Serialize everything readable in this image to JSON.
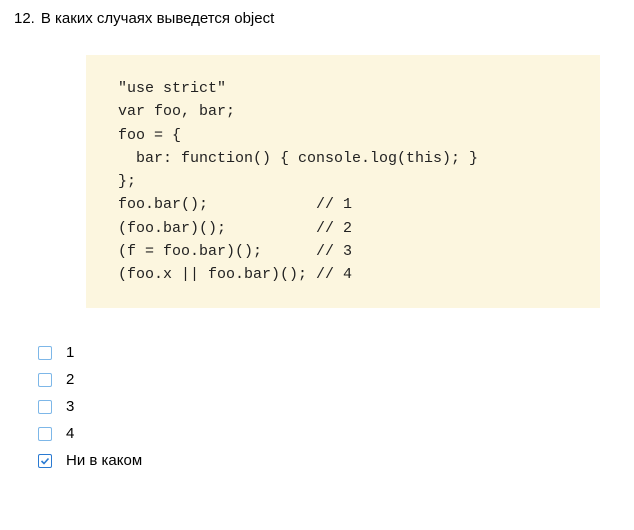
{
  "question": {
    "number": "12.",
    "text": "В каких случаях выведется object"
  },
  "code": "\"use strict\"\nvar foo, bar;\nfoo = {\n  bar: function() { console.log(this); }\n};\nfoo.bar();            // 1\n(foo.bar)();          // 2\n(f = foo.bar)();      // 3\n(foo.x || foo.bar)(); // 4",
  "options": [
    {
      "label": "1",
      "checked": false
    },
    {
      "label": "2",
      "checked": false
    },
    {
      "label": "3",
      "checked": false
    },
    {
      "label": "4",
      "checked": false
    },
    {
      "label": "Ни в каком",
      "checked": true
    }
  ]
}
